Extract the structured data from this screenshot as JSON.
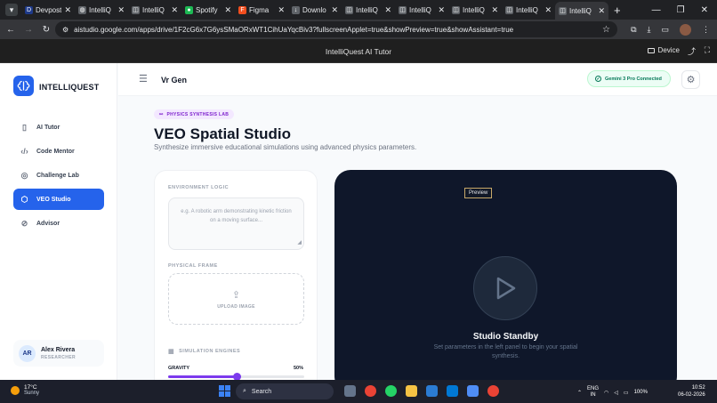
{
  "browser": {
    "tabs": [
      {
        "label": "Devpost",
        "favicon": "D",
        "color": "#1e3a8a"
      },
      {
        "label": "IntelliQ",
        "favicon": "◍",
        "color": "#5f6368"
      },
      {
        "label": "IntelliQ",
        "favicon": "◫",
        "color": "#5f6368"
      },
      {
        "label": "Spotify",
        "favicon": "●",
        "color": "#1db954"
      },
      {
        "label": "Figma",
        "favicon": "F",
        "color": "#f24e1e"
      },
      {
        "label": "Downlo",
        "favicon": "↓",
        "color": "#5f6368"
      },
      {
        "label": "IntelliQ",
        "favicon": "◫",
        "color": "#5f6368"
      },
      {
        "label": "IntelliQ",
        "favicon": "◫",
        "color": "#5f6368"
      },
      {
        "label": "IntelliQ",
        "favicon": "◫",
        "color": "#5f6368"
      },
      {
        "label": "IntelliQ",
        "favicon": "◫",
        "color": "#5f6368"
      },
      {
        "label": "IntelliQ",
        "favicon": "◫",
        "color": "#5f6368",
        "active": true
      }
    ],
    "url": "aistudio.google.com/apps/drive/1F2cG6x7G6ysSMaORxWT1CihUaYqcBiv3?fullscreenApplet=true&showPreview=true&showAssistant=true"
  },
  "appbar": {
    "title": "IntelliQuest AI Tutor",
    "device_label": "Device"
  },
  "sidebar": {
    "brand": "INTELLIQUEST",
    "items": [
      {
        "label": "AI Tutor",
        "icon": "book-icon"
      },
      {
        "label": "Code Mentor",
        "icon": "code-icon"
      },
      {
        "label": "Challenge Lab",
        "icon": "target-icon"
      },
      {
        "label": "VEO Studio",
        "icon": "cube-icon",
        "active": true
      },
      {
        "label": "Advisor",
        "icon": "compass-icon"
      }
    ],
    "user": {
      "initials": "AR",
      "name": "Alex Rivera",
      "role": "RESEARCHER"
    }
  },
  "topbar": {
    "page_label": "Vr Gen",
    "status": "Gemini 3 Pro Connected"
  },
  "main": {
    "badge": "PHYSICS SYNTHESIS LAB",
    "title": "VEO Spatial Studio",
    "subtitle": "Synthesize immersive educational simulations using advanced physics parameters."
  },
  "panel": {
    "env_label": "ENVIRONMENT LOGIC",
    "env_placeholder": "e.g. A robotic arm demonstrating kinetic friction on a moving surface...",
    "frame_label": "PHYSICAL FRAME",
    "upload_label": "UPLOAD IMAGE",
    "engines_label": "SIMULATION ENGINES",
    "gravity_label": "GRAVITY",
    "gravity_value": "50%",
    "gravity_fraction": 0.5
  },
  "stage": {
    "preview_tag": "Preview",
    "title": "Studio Standby",
    "description": "Set parameters in the left panel to begin your spatial synthesis."
  },
  "taskbar": {
    "temperature": "17°C",
    "condition": "Sunny",
    "search": "Search",
    "lang_1": "ENG",
    "lang_2": "IN",
    "battery": "100%",
    "time": "10:52",
    "date": "06-02-2026"
  },
  "colors": {
    "accent": "#2563eb",
    "purple": "#7c3aed",
    "stage_bg": "#0f172a",
    "status_green": "#047857"
  }
}
